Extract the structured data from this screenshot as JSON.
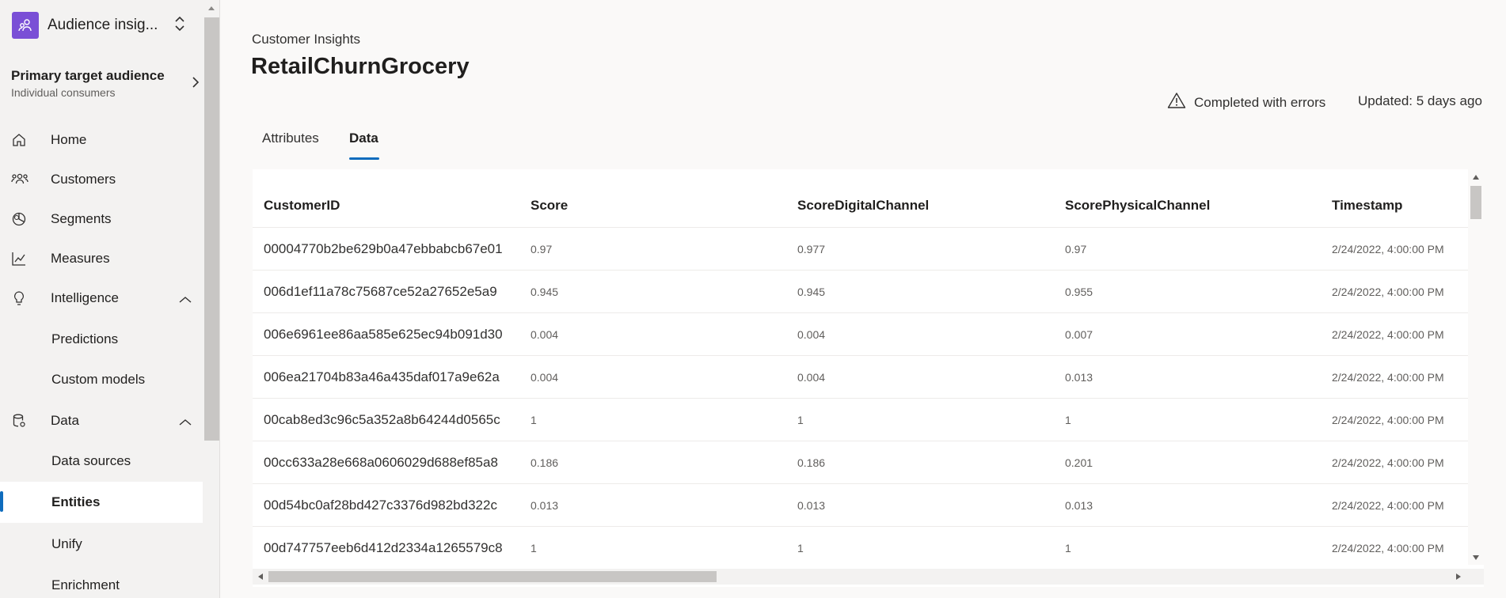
{
  "app": {
    "title": "Audience insig..."
  },
  "audience": {
    "title": "Primary target audience",
    "subtitle": "Individual consumers"
  },
  "nav": {
    "home": "Home",
    "customers": "Customers",
    "segments": "Segments",
    "measures": "Measures",
    "intelligence": "Intelligence",
    "predictions": "Predictions",
    "custom_models": "Custom models",
    "data": "Data",
    "data_sources": "Data sources",
    "entities": "Entities",
    "unify": "Unify",
    "enrichment": "Enrichment"
  },
  "page": {
    "breadcrumb": "Customer Insights",
    "title": "RetailChurnGrocery",
    "status": "Completed with errors",
    "updated": "Updated: 5 days ago"
  },
  "tabs": [
    {
      "label": "Attributes",
      "active": false
    },
    {
      "label": "Data",
      "active": true
    }
  ],
  "table": {
    "columns": [
      "CustomerID",
      "Score",
      "ScoreDigitalChannel",
      "ScorePhysicalChannel",
      "Timestamp"
    ],
    "rows": [
      [
        "00004770b2be629b0a47ebbabcb67e01",
        "0.97",
        "0.977",
        "0.97",
        "2/24/2022, 4:00:00 PM"
      ],
      [
        "006d1ef11a78c75687ce52a27652e5a9",
        "0.945",
        "0.945",
        "0.955",
        "2/24/2022, 4:00:00 PM"
      ],
      [
        "006e6961ee86aa585e625ec94b091d30",
        "0.004",
        "0.004",
        "0.007",
        "2/24/2022, 4:00:00 PM"
      ],
      [
        "006ea21704b83a46a435daf017a9e62a",
        "0.004",
        "0.004",
        "0.013",
        "2/24/2022, 4:00:00 PM"
      ],
      [
        "00cab8ed3c96c5a352a8b64244d0565c",
        "1",
        "1",
        "1",
        "2/24/2022, 4:00:00 PM"
      ],
      [
        "00cc633a28e668a0606029d688ef85a8",
        "0.186",
        "0.186",
        "0.201",
        "2/24/2022, 4:00:00 PM"
      ],
      [
        "00d54bc0af28bd427c3376d982bd322c",
        "0.013",
        "0.013",
        "0.013",
        "2/24/2022, 4:00:00 PM"
      ],
      [
        "00d747757eeb6d412d2334a1265579c8",
        "1",
        "1",
        "1",
        "2/24/2022, 4:00:00 PM"
      ]
    ]
  },
  "colors": {
    "accent": "#0f6cbd",
    "app_logo": "#7a4fd6"
  },
  "icons": {
    "app": "people-icon",
    "home": "home-icon",
    "customers": "customers-icon",
    "segments": "pie-chart-icon",
    "measures": "line-chart-icon",
    "intelligence": "lightbulb-icon",
    "data": "database-icon",
    "warning": "warning-icon"
  }
}
